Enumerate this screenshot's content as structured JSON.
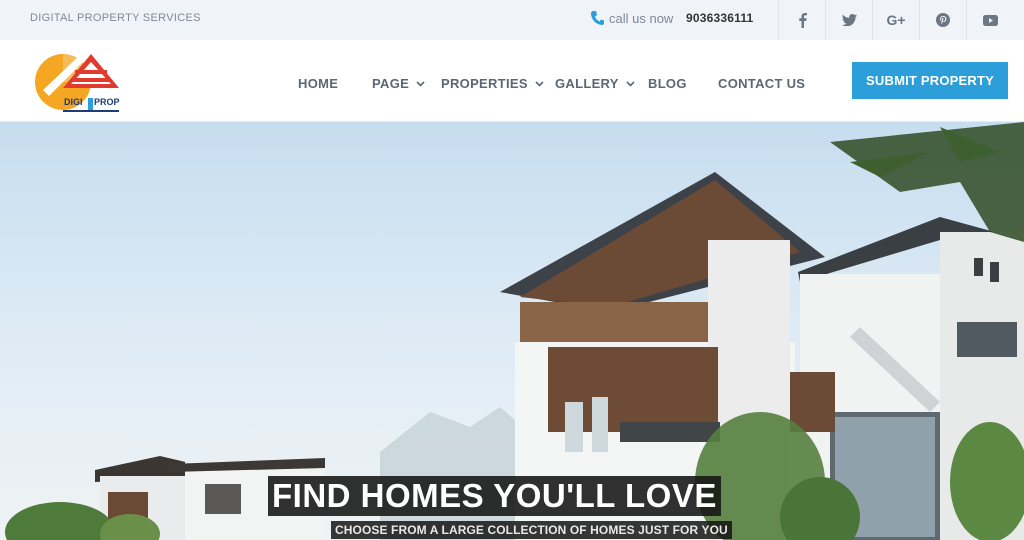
{
  "topbar": {
    "tagline": "DIGITAL PROPERTY SERVICES",
    "call_label": "call us now",
    "phone": "9036336111",
    "social": [
      {
        "icon": "facebook-icon",
        "glyph": "f"
      },
      {
        "icon": "twitter-icon",
        "glyph": "t"
      },
      {
        "icon": "google-plus-icon",
        "glyph": "G+"
      },
      {
        "icon": "pinterest-icon",
        "glyph": "p"
      },
      {
        "icon": "youtube-icon",
        "glyph": "▶"
      }
    ]
  },
  "logo": {
    "word1": "DIGI",
    "word2": "PROP"
  },
  "nav": {
    "items": [
      {
        "label": "HOME",
        "dropdown": false
      },
      {
        "label": "PAGE",
        "dropdown": true
      },
      {
        "label": "PROPERTIES",
        "dropdown": true
      },
      {
        "label": "GALLERY",
        "dropdown": true
      },
      {
        "label": "BLOG",
        "dropdown": false
      },
      {
        "label": "CONTACT US",
        "dropdown": false
      }
    ],
    "submit_label": "SUBMIT PROPERTY"
  },
  "hero": {
    "title": "FIND HOMES YOU'LL LOVE",
    "subtitle": "CHOOSE FROM A LARGE COLLECTION OF HOMES JUST FOR YOU"
  },
  "colors": {
    "accent": "#2c9fdb",
    "topbar_bg": "#f0f4f8",
    "nav_text": "#5c6773"
  }
}
